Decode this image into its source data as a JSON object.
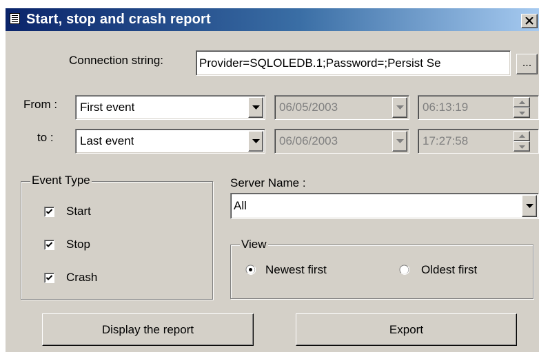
{
  "window": {
    "title": "Start, stop and crash report"
  },
  "connection": {
    "label": "Connection string:",
    "value": "Provider=SQLOLEDB.1;Password=;Persist Se",
    "browse_label": "..."
  },
  "range": {
    "from_label": "From :",
    "to_label": "to :",
    "from_event": "First event",
    "to_event": "Last event",
    "from_date": "06/05/2003",
    "to_date": "06/06/2003",
    "from_time": "06:13:19",
    "to_time": "17:27:58"
  },
  "event_type": {
    "legend": "Event Type",
    "options": [
      {
        "label": "Start",
        "checked": true
      },
      {
        "label": "Stop",
        "checked": true
      },
      {
        "label": "Crash",
        "checked": true
      }
    ]
  },
  "server": {
    "label": "Server Name :",
    "value": "All"
  },
  "view": {
    "legend": "View",
    "options": [
      {
        "label": "Newest first",
        "selected": true
      },
      {
        "label": "Oldest first",
        "selected": false
      }
    ]
  },
  "buttons": {
    "display_report": "Display the report",
    "export": "Export"
  },
  "icons": {
    "title": "report-icon",
    "close": "close-icon",
    "dropdown": "chevron-down-icon",
    "spinner": "spin-updown-icon"
  },
  "colors": {
    "dialog_face": "#d4d0c8",
    "title_start": "#0a246a",
    "title_end": "#a6caf0",
    "disabled_text": "#808080"
  }
}
